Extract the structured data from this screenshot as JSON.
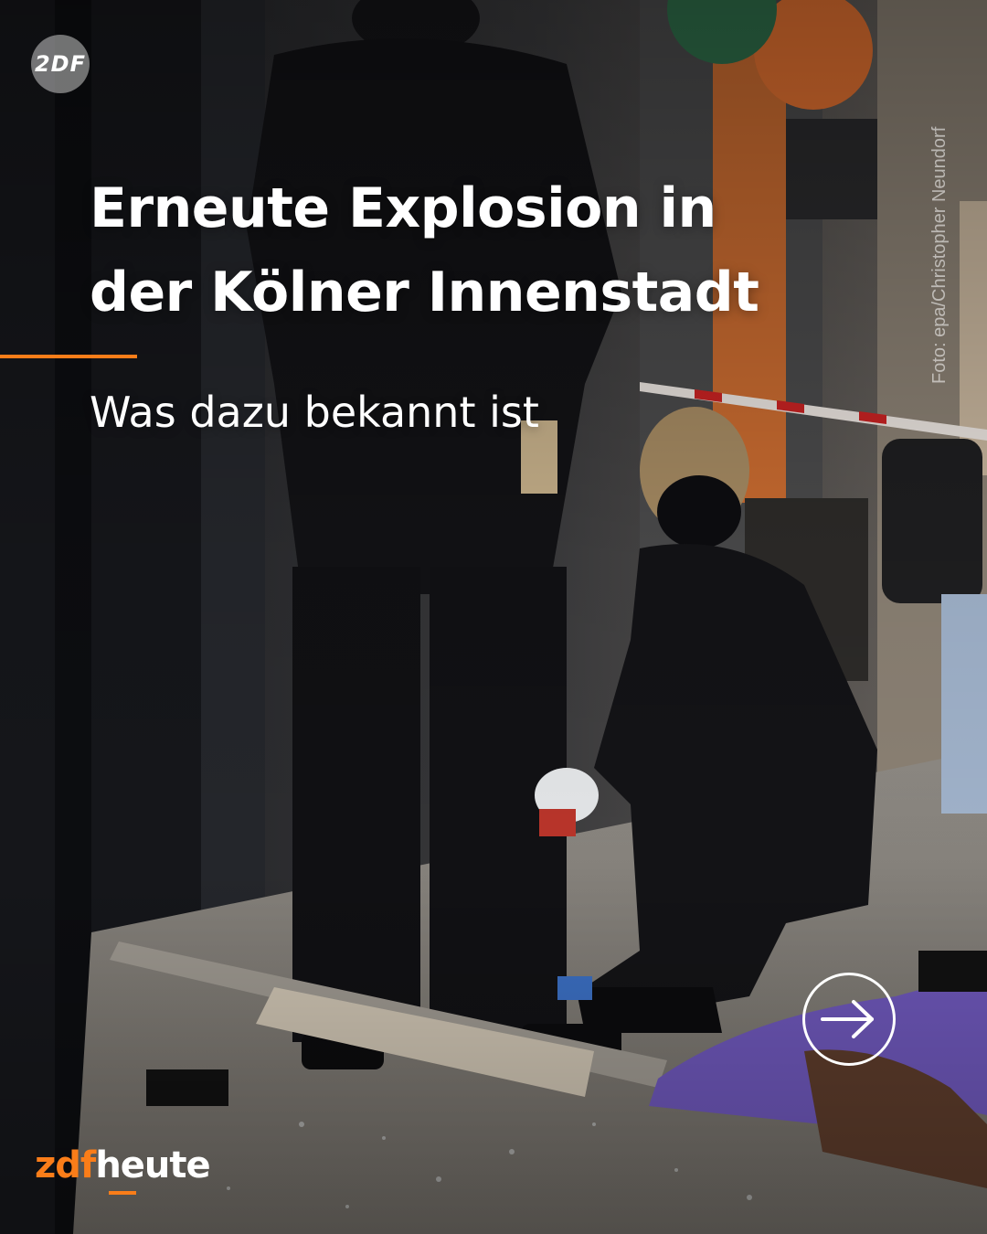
{
  "post": {
    "title_line1": "Erneute Explosion in",
    "title_line2": "der Kölner Innenstadt",
    "subtitle": "Was dazu bekannt ist",
    "photo_credit": "Foto: epa/Christopher Neundorf"
  },
  "branding": {
    "badge_text": "2DF",
    "logo_part1": "zdf",
    "logo_part2": "heute"
  },
  "icons": {
    "next": "arrow-right-circle-icon"
  },
  "colors": {
    "accent": "#fa7d19",
    "text": "#ffffff"
  }
}
